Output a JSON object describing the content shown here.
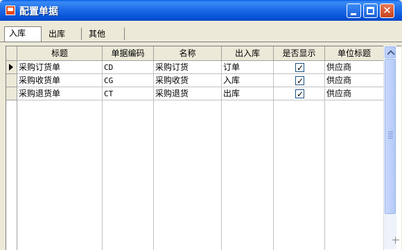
{
  "window": {
    "title": "配置单据",
    "icon": "app-icon"
  },
  "tabs": [
    "入库",
    "出库",
    "其他"
  ],
  "active_tab": "入库",
  "grid": {
    "columns": [
      "标题",
      "单据编码",
      "名称",
      "出入库",
      "是否显示",
      "单位标题"
    ],
    "rows": [
      {
        "title": "采购订货单",
        "code": "CD",
        "name": "采购订货",
        "inout": "订单",
        "show": true,
        "unit": "供应商"
      },
      {
        "title": "采购收货单",
        "code": "CG",
        "name": "采购收货",
        "inout": "入库",
        "show": true,
        "unit": "供应商"
      },
      {
        "title": "采购退货单",
        "code": "CT",
        "name": "采购退货",
        "inout": "出库",
        "show": true,
        "unit": "供应商"
      }
    ],
    "current_row_indicator": "arrow-right-icon",
    "check_mark": "✓"
  },
  "colors": {
    "title_bar": "#0A5FE8",
    "window_bg": "#ECE9D8",
    "close_button": "#C9401A"
  }
}
